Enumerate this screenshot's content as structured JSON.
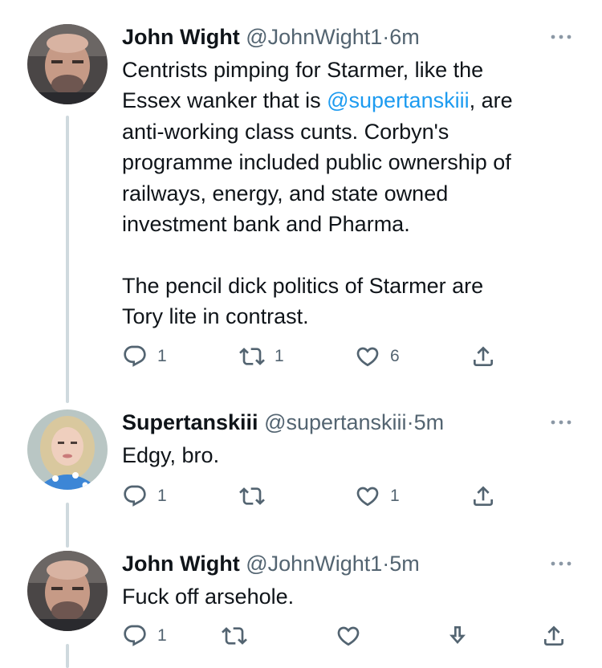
{
  "tweets": [
    {
      "name": "John Wight",
      "handle": "@JohnWight1",
      "dot": "·",
      "time": "6m",
      "text_part1": "Centrists pimping for Starmer, like the\nEssex wanker that is ",
      "mention": "@supertanskiii",
      "text_part2": ", are\nanti-working class cunts. Corbyn's\nprogramme included public ownership of\nrailways, energy, and state owned\ninvestment bank and Pharma.\n\nThe pencil dick politics of Starmer are\nTory lite in contrast.",
      "reply_count": "1",
      "retweet_count": "1",
      "like_count": "6"
    },
    {
      "name": "Supertanskiii",
      "handle": "@supertanskiii",
      "dot": "·",
      "time": "5m",
      "text": "Edgy, bro.",
      "reply_count": "1",
      "retweet_count": "",
      "like_count": "1"
    },
    {
      "name": "John Wight",
      "handle": "@JohnWight1",
      "dot": "·",
      "time": "5m",
      "text": "Fuck off arsehole.",
      "reply_count": "1",
      "retweet_count": "",
      "like_count": ""
    }
  ],
  "icons": {
    "reply": "reply-icon",
    "retweet": "retweet-icon",
    "like": "heart-icon",
    "share": "share-icon",
    "hide_reply": "hide-reply-icon",
    "more": "more-icon"
  },
  "colors": {
    "text": "#0f1419",
    "secondary": "#536471",
    "mention": "#1d9bf0",
    "thread_line": "#cfd9de"
  }
}
